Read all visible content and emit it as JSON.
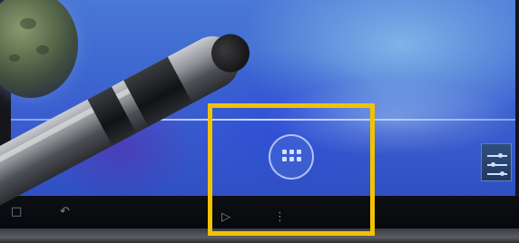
{
  "scene": {
    "apps_icon": "apps-grid-icon",
    "settings_icon": "settings-sliders-icon",
    "stylus": "stylus-pen",
    "highlight_color": "#f2c200",
    "wallpaper_color": "#3b5fd0"
  }
}
